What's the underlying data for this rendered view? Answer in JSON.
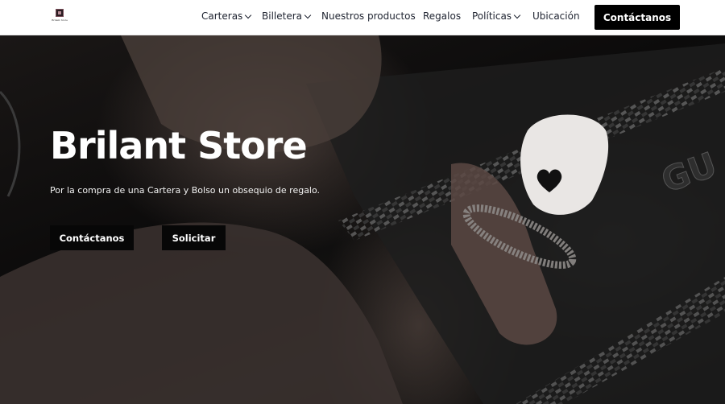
{
  "header": {
    "logo_text": "Brilant Store",
    "nav": [
      {
        "label": "Carteras",
        "has_dropdown": true
      },
      {
        "label": "Billetera",
        "has_dropdown": true
      },
      {
        "label": "Nuestros productos",
        "has_dropdown": false
      },
      {
        "label": "Regalos",
        "has_dropdown": false
      },
      {
        "label": "Políticas",
        "has_dropdown": true
      },
      {
        "label": "Ubicación",
        "has_dropdown": false
      }
    ],
    "cta_label": "Contáctanos"
  },
  "hero": {
    "title": "Brilant Store",
    "subtitle": "Por la compra de una Cartera y Bolso un obsequio de regalo.",
    "primary_button": "Contáctanos",
    "secondary_button": "Solicitar",
    "bag_text": "GU"
  },
  "colors": {
    "header_bg": "#ffffff",
    "nav_text": "#1e2330",
    "button_bg": "#000000",
    "hero_text": "#ffffff"
  }
}
